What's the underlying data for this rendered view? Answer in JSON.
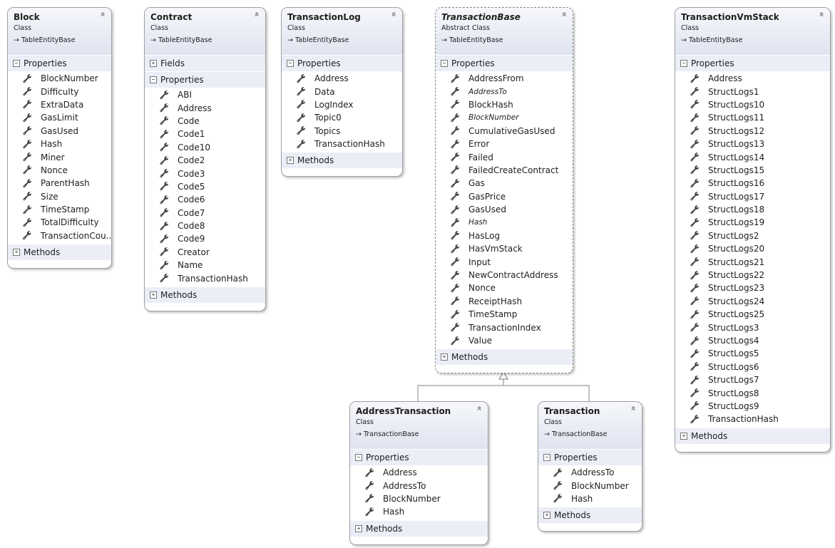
{
  "diagram": {
    "collapse_glyph": "«",
    "classes": [
      {
        "name": "Block",
        "kind": "Class",
        "base": "TableEntityBase",
        "sections": [
          {
            "label": "Properties",
            "expanded": true,
            "items": [
              {
                "name": "BlockNumber"
              },
              {
                "name": "Difficulty"
              },
              {
                "name": "ExtraData"
              },
              {
                "name": "GasLimit"
              },
              {
                "name": "GasUsed"
              },
              {
                "name": "Hash"
              },
              {
                "name": "Miner"
              },
              {
                "name": "Nonce"
              },
              {
                "name": "ParentHash"
              },
              {
                "name": "Size"
              },
              {
                "name": "TimeStamp"
              },
              {
                "name": "TotalDifficulty"
              },
              {
                "name": "TransactionCou..."
              }
            ]
          },
          {
            "label": "Methods",
            "expanded": false,
            "items": []
          }
        ]
      },
      {
        "name": "Contract",
        "kind": "Class",
        "base": "TableEntityBase",
        "sections": [
          {
            "label": "Fields",
            "expanded": false,
            "items": []
          },
          {
            "label": "Properties",
            "expanded": true,
            "items": [
              {
                "name": "ABI"
              },
              {
                "name": "Address"
              },
              {
                "name": "Code"
              },
              {
                "name": "Code1"
              },
              {
                "name": "Code10"
              },
              {
                "name": "Code2"
              },
              {
                "name": "Code3"
              },
              {
                "name": "Code5"
              },
              {
                "name": "Code6"
              },
              {
                "name": "Code7"
              },
              {
                "name": "Code8"
              },
              {
                "name": "Code9"
              },
              {
                "name": "Creator"
              },
              {
                "name": "Name"
              },
              {
                "name": "TransactionHash"
              }
            ]
          },
          {
            "label": "Methods",
            "expanded": false,
            "items": []
          }
        ]
      },
      {
        "name": "TransactionLog",
        "kind": "Class",
        "base": "TableEntityBase",
        "sections": [
          {
            "label": "Properties",
            "expanded": true,
            "items": [
              {
                "name": "Address"
              },
              {
                "name": "Data"
              },
              {
                "name": "LogIndex"
              },
              {
                "name": "Topic0"
              },
              {
                "name": "Topics"
              },
              {
                "name": "TransactionHash"
              }
            ]
          },
          {
            "label": "Methods",
            "expanded": false,
            "items": []
          }
        ]
      },
      {
        "name": "TransactionBase",
        "kind": "Abstract Class",
        "abstract": true,
        "base": "TableEntityBase",
        "sections": [
          {
            "label": "Properties",
            "expanded": true,
            "items": [
              {
                "name": "AddressFrom"
              },
              {
                "name": "AddressTo",
                "italic": true
              },
              {
                "name": "BlockHash"
              },
              {
                "name": "BlockNumber",
                "italic": true
              },
              {
                "name": "CumulativeGasUsed"
              },
              {
                "name": "Error"
              },
              {
                "name": "Failed"
              },
              {
                "name": "FailedCreateContract"
              },
              {
                "name": "Gas"
              },
              {
                "name": "GasPrice"
              },
              {
                "name": "GasUsed"
              },
              {
                "name": "Hash",
                "italic": true
              },
              {
                "name": "HasLog"
              },
              {
                "name": "HasVmStack"
              },
              {
                "name": "Input"
              },
              {
                "name": "NewContractAddress"
              },
              {
                "name": "Nonce"
              },
              {
                "name": "ReceiptHash"
              },
              {
                "name": "TimeStamp"
              },
              {
                "name": "TransactionIndex"
              },
              {
                "name": "Value"
              }
            ]
          },
          {
            "label": "Methods",
            "expanded": false,
            "items": []
          }
        ]
      },
      {
        "name": "TransactionVmStack",
        "kind": "Class",
        "base": "TableEntityBase",
        "sections": [
          {
            "label": "Properties",
            "expanded": true,
            "items": [
              {
                "name": "Address"
              },
              {
                "name": "StructLogs1"
              },
              {
                "name": "StructLogs10"
              },
              {
                "name": "StructLogs11"
              },
              {
                "name": "StructLogs12"
              },
              {
                "name": "StructLogs13"
              },
              {
                "name": "StructLogs14"
              },
              {
                "name": "StructLogs15"
              },
              {
                "name": "StructLogs16"
              },
              {
                "name": "StructLogs17"
              },
              {
                "name": "StructLogs18"
              },
              {
                "name": "StructLogs19"
              },
              {
                "name": "StructLogs2"
              },
              {
                "name": "StructLogs20"
              },
              {
                "name": "StructLogs21"
              },
              {
                "name": "StructLogs22"
              },
              {
                "name": "StructLogs23"
              },
              {
                "name": "StructLogs24"
              },
              {
                "name": "StructLogs25"
              },
              {
                "name": "StructLogs3"
              },
              {
                "name": "StructLogs4"
              },
              {
                "name": "StructLogs5"
              },
              {
                "name": "StructLogs6"
              },
              {
                "name": "StructLogs7"
              },
              {
                "name": "StructLogs8"
              },
              {
                "name": "StructLogs9"
              },
              {
                "name": "TransactionHash"
              }
            ]
          },
          {
            "label": "Methods",
            "expanded": false,
            "items": []
          }
        ]
      },
      {
        "name": "AddressTransaction",
        "kind": "Class",
        "base": "TransactionBase",
        "sections": [
          {
            "label": "Properties",
            "expanded": true,
            "items": [
              {
                "name": "Address"
              },
              {
                "name": "AddressTo"
              },
              {
                "name": "BlockNumber"
              },
              {
                "name": "Hash"
              }
            ]
          },
          {
            "label": "Methods",
            "expanded": false,
            "items": []
          }
        ]
      },
      {
        "name": "Transaction",
        "kind": "Class",
        "base": "TransactionBase",
        "sections": [
          {
            "label": "Properties",
            "expanded": true,
            "items": [
              {
                "name": "AddressTo"
              },
              {
                "name": "BlockNumber"
              },
              {
                "name": "Hash"
              }
            ]
          },
          {
            "label": "Methods",
            "expanded": false,
            "items": []
          }
        ]
      }
    ],
    "inheritance": [
      {
        "child": "AddressTransaction",
        "parent": "TransactionBase"
      },
      {
        "child": "Transaction",
        "parent": "TransactionBase"
      }
    ]
  }
}
